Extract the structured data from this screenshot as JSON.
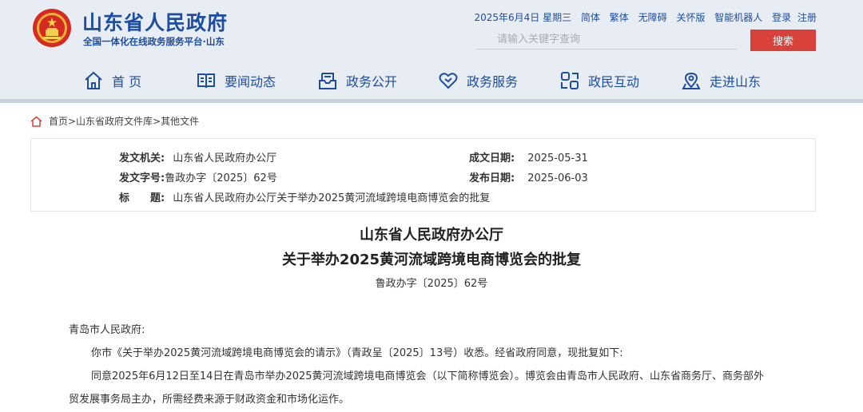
{
  "site": {
    "title": "山东省人民政府",
    "subtitle": "全国一体化在线政务服务平台·山东"
  },
  "topbar": {
    "date": "2025年6月4日 星期三",
    "links": [
      "简体",
      "繁体",
      "无障碍",
      "关怀版",
      "智能机器人",
      "登录",
      "注册"
    ]
  },
  "search": {
    "placeholder": "请输入关键字查询",
    "button": "搜索"
  },
  "nav": [
    {
      "label": "首 页",
      "icon": "home-icon"
    },
    {
      "label": "要闻动态",
      "icon": "book-icon"
    },
    {
      "label": "政务公开",
      "icon": "inbox-icon"
    },
    {
      "label": "政务服务",
      "icon": "heart-icon"
    },
    {
      "label": "政民互动",
      "icon": "link-icon"
    },
    {
      "label": "走进山东",
      "icon": "location-icon"
    }
  ],
  "breadcrumb": "首页>山东省政府文件库>其他文件",
  "info": {
    "issuer_label": "发文机关:",
    "issuer": "山东省人民政府办公厅",
    "doc_no_label": "发文字号:",
    "doc_no": "鲁政办字〔2025〕62号",
    "title_label": "标　　题:",
    "title": "山东省人民政府办公厅关于举办2025黄河流域跨境电商博览会的批复",
    "created_label": "成文日期:",
    "created": "2025-05-31",
    "published_label": "发布日期:",
    "published": "2025-06-03"
  },
  "document": {
    "title_line1": "山东省人民政府办公厅",
    "title_line2": "关于举办2025黄河流域跨境电商博览会的批复",
    "doc_no": "鲁政办字〔2025〕62号",
    "salutation": "青岛市人民政府:",
    "para1": "你市《关于举办2025黄河流域跨境电商博览会的请示》（青政呈〔2025〕13号）收悉。经省政府同意，现批复如下:",
    "para2_line1": "同意2025年6月12日至14日在青岛市举办2025黄河流域跨境电商博览会（以下简称博览会）。博览会由青岛市人民政府、山东省商务厅、商务部外",
    "para2_line2": "贸发展事务局主办，所需经费来源于财政资金和市场化运作。"
  },
  "colors": {
    "brand_blue": "#1e4ea3",
    "search_red": "#d9413b",
    "header_bg": "#e8ecf3"
  }
}
